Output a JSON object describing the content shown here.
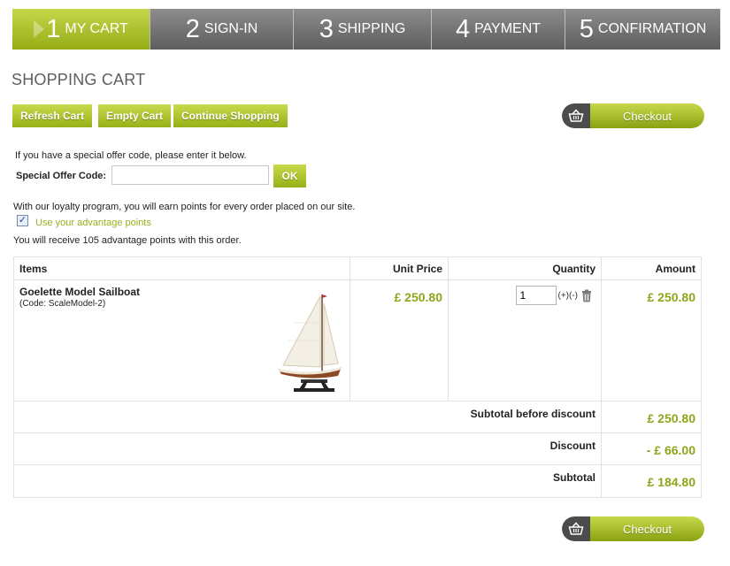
{
  "steps": [
    {
      "num": "1",
      "label": "MY CART"
    },
    {
      "num": "2",
      "label": "SIGN-IN"
    },
    {
      "num": "3",
      "label": "SHIPPING"
    },
    {
      "num": "4",
      "label": "PAYMENT"
    },
    {
      "num": "5",
      "label": "CONFIRMATION"
    }
  ],
  "page_title": "SHOPPING CART",
  "toolbar": {
    "refresh_label": "Refresh Cart",
    "empty_label": "Empty Cart",
    "continue_label": "Continue Shopping",
    "checkout_label": "Checkout"
  },
  "offer": {
    "intro": "If you have a special offer code, please enter it below.",
    "label": "Special Offer Code:",
    "value": "",
    "ok_label": "OK"
  },
  "loyalty": {
    "intro": "With our loyalty program, you will earn points for every order placed on our site.",
    "checkbox_label": "Use your advantage points",
    "checked": true,
    "points_text": "You will receive 105 advantage points with this order."
  },
  "table": {
    "headers": {
      "items": "Items",
      "unit_price": "Unit Price",
      "quantity": "Quantity",
      "amount": "Amount"
    },
    "items": [
      {
        "name": "Goelette Model Sailboat",
        "code": "(Code: ScaleModel-2)",
        "unit_price": "£ 250.80",
        "quantity": "1",
        "plus_minus": "(+)(-)",
        "amount": "£ 250.80"
      }
    ],
    "summary": [
      {
        "label": "Subtotal before discount",
        "value": "£ 250.80"
      },
      {
        "label": "Discount",
        "value": "- £ 66.00"
      },
      {
        "label": "Subtotal",
        "value": "£ 184.80"
      }
    ]
  },
  "colors": {
    "accent": "#9aae1c",
    "step_active": "#b3c634",
    "step_inactive": "#757575"
  },
  "icons": {
    "basket": "basket-icon",
    "trash": "trash-icon",
    "arrow": "arrow-icon"
  }
}
